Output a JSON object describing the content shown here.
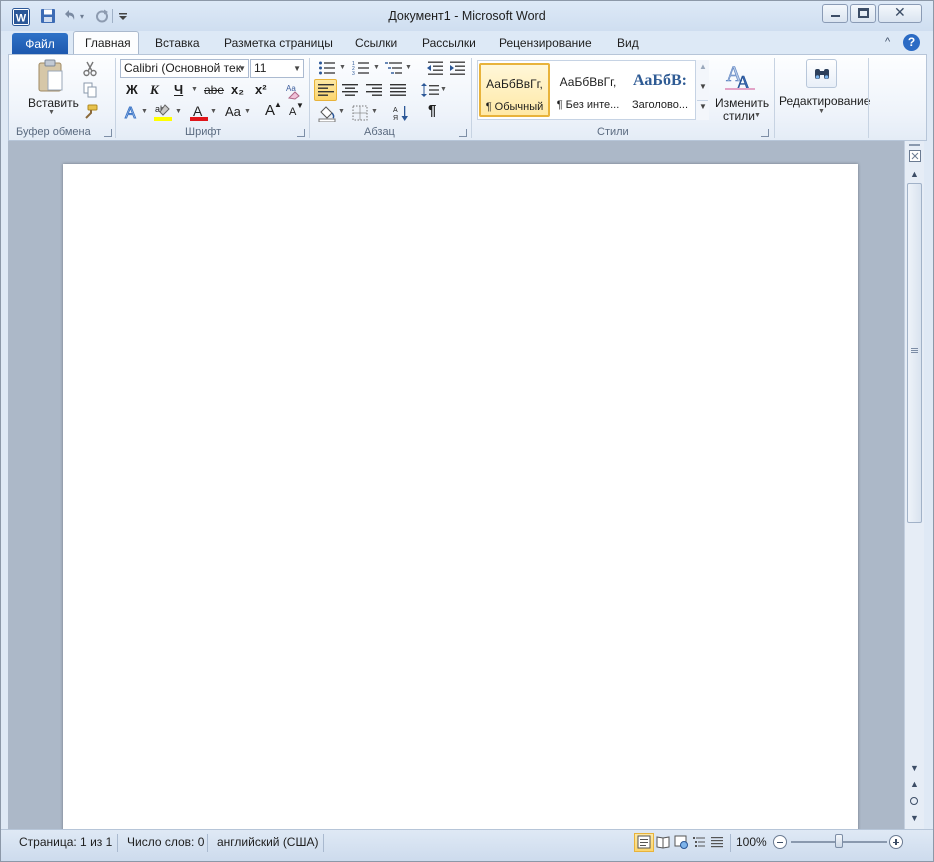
{
  "window": {
    "title": "Документ1 - Microsoft Word"
  },
  "quick_access": {
    "icons": [
      "word-logo-icon",
      "save-icon",
      "undo-icon",
      "redo-icon",
      "customize-qat-icon"
    ]
  },
  "tabs": {
    "file": "Файл",
    "items": [
      "Главная",
      "Вставка",
      "Разметка страницы",
      "Ссылки",
      "Рассылки",
      "Рецензирование",
      "Вид"
    ],
    "active_index": 0
  },
  "ribbon": {
    "clipboard": {
      "paste_label": "Вставить",
      "group_label": "Буфер обмена"
    },
    "font": {
      "font_name": "Calibri (Основной тек",
      "font_size": "11",
      "bold_label": "Ж",
      "italic_label": "К",
      "underline_label": "Ч",
      "strike_label": "abe",
      "subscript_label": "x₂",
      "superscript_label": "x²",
      "grow_font_label": "A",
      "shrink_font_label": "A",
      "change_case_label": "Aa",
      "group_label": "Шрифт"
    },
    "paragraph": {
      "show_marks_label": "¶",
      "group_label": "Абзац"
    },
    "styles": {
      "items": [
        {
          "sample": "АаБбВвГг,",
          "name": "¶ Обычный"
        },
        {
          "sample": "АаБбВвГг,",
          "name": "¶ Без инте..."
        },
        {
          "sample": "АаБбВ:",
          "name": "Заголово..."
        }
      ],
      "change_styles_line1": "Изменить",
      "change_styles_line2": "стили",
      "group_label": "Стили"
    },
    "editing": {
      "label": "Редактирование"
    }
  },
  "statusbar": {
    "page": "Страница: 1 из 1",
    "words": "Число слов: 0",
    "language": "английский (США)",
    "zoom": "100%",
    "zoom_level": 1.0
  },
  "colors": {
    "accent": "#2b6bc4",
    "highlight": "#ffff00",
    "font_color": "#e0151a",
    "style_selected_border": "#e8b33b"
  }
}
